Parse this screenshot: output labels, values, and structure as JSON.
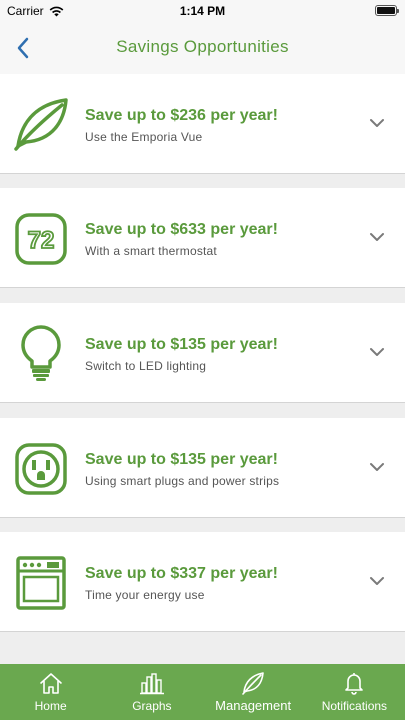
{
  "status_bar": {
    "carrier": "Carrier",
    "time": "1:14 PM"
  },
  "header": {
    "title": "Savings Opportunities"
  },
  "opportunities": [
    {
      "headline": "Save up to $236 per year!",
      "subtitle": "Use the Emporia Vue",
      "icon": "leaf-icon"
    },
    {
      "headline": "Save up to $633 per year!",
      "subtitle": "With a smart thermostat",
      "icon": "thermostat-icon",
      "icon_text": "72"
    },
    {
      "headline": "Save up to $135 per year!",
      "subtitle": "Switch to LED lighting",
      "icon": "lightbulb-icon"
    },
    {
      "headline": "Save up to $135 per year!",
      "subtitle": "Using smart plugs and power strips",
      "icon": "outlet-icon"
    },
    {
      "headline": "Save up to $337 per year!",
      "subtitle": "Time your energy use",
      "icon": "appliance-icon"
    }
  ],
  "tab_bar": {
    "tabs": [
      {
        "label": "Home",
        "icon": "home-icon"
      },
      {
        "label": "Graphs",
        "icon": "graphs-icon"
      },
      {
        "label": "Management",
        "icon": "leaf-icon"
      },
      {
        "label": "Notifications",
        "icon": "bell-icon"
      }
    ]
  },
  "colors": {
    "accent": "#5a9a3c",
    "tab_bar": "#6aa84f",
    "background": "#eeeeee"
  }
}
